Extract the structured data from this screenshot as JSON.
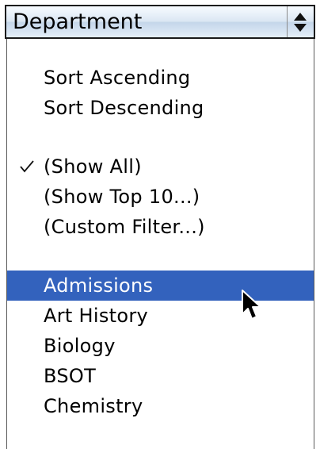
{
  "popup": {
    "selected_value": "Department",
    "arrows_icon": "updown-arrows-icon"
  },
  "menu": {
    "sort_ascending": "Sort Ascending",
    "sort_descending": "Sort Descending",
    "show_all": "(Show All)",
    "show_all_checked": true,
    "check_icon": "checkmark-icon",
    "show_top_10": "(Show Top 10...)",
    "custom_filter": "(Custom Filter...)",
    "values": [
      "Admissions",
      "Art History",
      "Biology",
      "BSOT",
      "Chemistry"
    ],
    "highlighted_value": "Admissions"
  },
  "colors": {
    "highlight": "#3362bd",
    "highlight_text": "#ffffff",
    "text": "#000000"
  },
  "cursor_icon": "arrow-pointer-icon"
}
